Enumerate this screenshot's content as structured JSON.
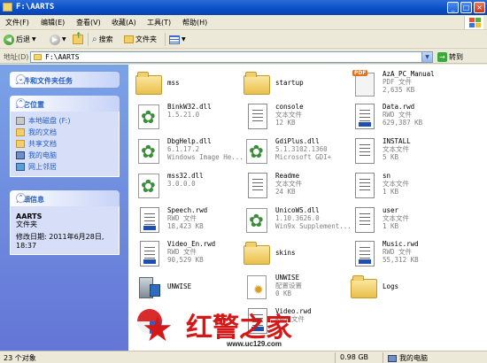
{
  "window": {
    "title": "F:\\AARTS",
    "minimize": "_",
    "maximize": "□",
    "close": "×"
  },
  "menu": {
    "items": [
      "文件(F)",
      "编辑(E)",
      "查看(V)",
      "收藏(A)",
      "工具(T)",
      "帮助(H)"
    ]
  },
  "toolbar": {
    "back_label": "后退",
    "search_label": "搜索",
    "folders_label": "文件夹"
  },
  "address": {
    "label": "地址(D)",
    "value": "F:\\AARTS",
    "go_label": "转到"
  },
  "tasks": {
    "file_tasks_title": "文件和文件夹任务",
    "other_places_title": "其它位置",
    "other_places": [
      {
        "label": "本地磁盘 (F:)",
        "icon": "drive-icon"
      },
      {
        "label": "我的文档",
        "icon": "folder-icon"
      },
      {
        "label": "共享文档",
        "icon": "folder-icon"
      },
      {
        "label": "我的电脑",
        "icon": "computer-icon"
      },
      {
        "label": "网上邻居",
        "icon": "network-icon"
      }
    ],
    "details_title": "详细信息",
    "details": {
      "name": "AARTS",
      "type": "文件夹",
      "modified_line1": "修改日期: 2011年6月28日,",
      "modified_line2": "18:37"
    }
  },
  "files": [
    {
      "name": "mss",
      "type": "",
      "size": "",
      "icon": "folder"
    },
    {
      "name": "startup",
      "type": "",
      "size": "",
      "icon": "folder"
    },
    {
      "name": "AzA_PC_Manual",
      "type": "PDF 文件",
      "size": "2,635 KB",
      "icon": "pdf"
    },
    {
      "name": "BinkW32.dll",
      "type": "1.5.21.0",
      "size": "",
      "icon": "dll"
    },
    {
      "name": "console",
      "type": "文本文件",
      "size": "12 KB",
      "icon": "txt"
    },
    {
      "name": "Data.rwd",
      "type": "RWD 文件",
      "size": "629,387 KB",
      "icon": "rwd"
    },
    {
      "name": "DbgHelp.dll",
      "type": "6.1.17.2",
      "size": "Windows Image He...",
      "icon": "dll"
    },
    {
      "name": "GdiPlus.dll",
      "type": "5.1.3102.1360",
      "size": "Microsoft GDI+",
      "icon": "dll"
    },
    {
      "name": "INSTALL",
      "type": "文本文件",
      "size": "5 KB",
      "icon": "txt"
    },
    {
      "name": "mss32.dll",
      "type": "3.0.0.0",
      "size": "",
      "icon": "dll"
    },
    {
      "name": "Readme",
      "type": "文本文件",
      "size": "24 KB",
      "icon": "txt"
    },
    {
      "name": "sn",
      "type": "文本文件",
      "size": "1 KB",
      "icon": "txt"
    },
    {
      "name": "Speech.rwd",
      "type": "RWD 文件",
      "size": "18,423 KB",
      "icon": "rwd"
    },
    {
      "name": "UnicoWS.dll",
      "type": "1.10.3626.0",
      "size": "Win9x Supplement...",
      "icon": "dll"
    },
    {
      "name": "user",
      "type": "文本文件",
      "size": "1 KB",
      "icon": "txt"
    },
    {
      "name": "Video_En.rwd",
      "type": "RWD 文件",
      "size": "90,529 KB",
      "icon": "rwd"
    },
    {
      "name": "skins",
      "type": "",
      "size": "",
      "icon": "folder"
    },
    {
      "name": "Music.rwd",
      "type": "RWD 文件",
      "size": "55,312 KB",
      "icon": "rwd"
    },
    {
      "name": "UNWISE",
      "type": "",
      "size": "",
      "icon": "exe"
    },
    {
      "name": "UNWISE",
      "type": "配置设置",
      "size": "0 KB",
      "icon": "cfg"
    },
    {
      "name": "Logs",
      "type": "",
      "size": "",
      "icon": "folder"
    },
    {
      "name": "",
      "type": "",
      "size": "",
      "icon": "logo"
    },
    {
      "name": "Video.rwd",
      "type": "RWD 文件",
      "size": "",
      "icon": "rwd"
    }
  ],
  "watermark": {
    "brand": "红警之家",
    "url": "www.uc129.com"
  },
  "status": {
    "count": "23 个对象",
    "size": "0.98 GB",
    "location": "我的电脑"
  }
}
